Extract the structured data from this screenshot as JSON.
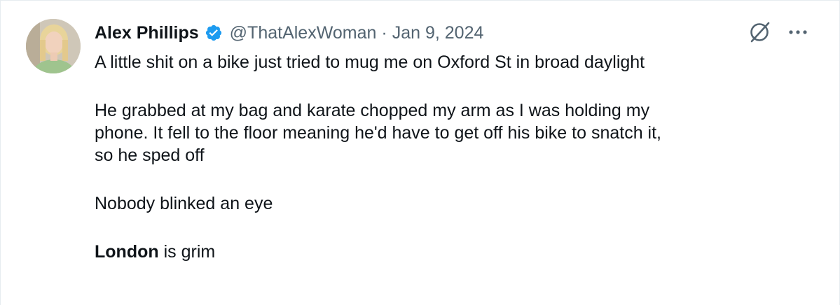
{
  "tweet": {
    "author_name": "Alex Phillips",
    "handle": "@ThatAlexWoman",
    "separator": "·",
    "date": "Jan 9, 2024",
    "verified_color": "#1d9bf0",
    "avatar_icon": "profile-photo",
    "paragraphs": {
      "p1": "A little shit on a bike just tried to mug me on Oxford St in broad daylight",
      "p2_line1": "He grabbed at my bag and karate chopped my arm as I was holding  my",
      "p2_line2": "phone. It fell to the floor meaning he'd have to get off his bike to snatch it,",
      "p2_line3": "so he sped off",
      "p3": "Nobody blinked an eye",
      "p4_bold": "London",
      "p4_rest": " is grim"
    },
    "icons": {
      "grok": "grok-icon",
      "more": "more-options-icon"
    },
    "colors": {
      "text": "#0f1419",
      "secondary": "#536471",
      "verified": "#1d9bf0"
    }
  }
}
